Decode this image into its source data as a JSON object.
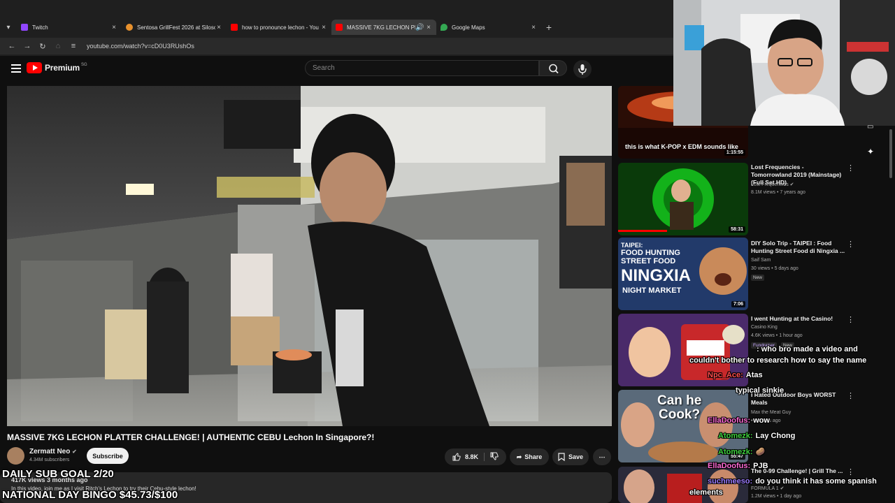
{
  "browser": {
    "tabs": [
      {
        "title": "Twitch",
        "favicon_color": "#9146ff",
        "active": false
      },
      {
        "title": "Sentosa GrillFest 2026 at Siloso",
        "favicon_color": "#e8912d",
        "active": false
      },
      {
        "title": "how to pronounce lechon - You",
        "favicon_color": "#ff0000",
        "active": false
      },
      {
        "title": "MASSIVE 7KG LECHON PLA",
        "favicon_color": "#ff0000",
        "active": true
      },
      {
        "title": "Google Maps",
        "favicon_color": "#34a853",
        "active": false
      }
    ],
    "url": "youtube.com/watch?v=cD0U3RUshOs"
  },
  "youtube": {
    "logo_text": "Premium",
    "logo_sup": "SG",
    "search_placeholder": "Search"
  },
  "video": {
    "title": "MASSIVE 7KG LECHON PLATTER CHALLENGE! | AUTHENTIC CEBU Lechon In Singapore?!",
    "channel_name": "Zermatt Neo",
    "subscribers": "4.34M subscribers",
    "subscribe_label": "Subscribe",
    "likes": "8.8K",
    "share_label": "Share",
    "save_label": "Save",
    "desc_meta": "417K views  3 months ago",
    "desc_text": "In this video, join me as I visit Ritch's Lechon to try their Cebu-style lechon!"
  },
  "recommendations": [
    {
      "title": "this is what K-POP x EDM sounds like",
      "duration": "1:15:55",
      "channel": "",
      "meta": "",
      "badges": []
    },
    {
      "title": "Lost Frequencies - Tomorrowland 2019 (Mainstage) (Full Set HD)",
      "duration": "58:31",
      "channel": "Lost Frequencies",
      "meta": "8.1M views • 7 years ago",
      "badges": []
    },
    {
      "title": "DIY Solo Trip - TAIPEI : Food Hunting Street Food di Ningxia ...",
      "duration": "7:06",
      "channel": "Saif Sam",
      "meta": "30 views • 5 days ago",
      "badges": [
        "New"
      ],
      "thumb_text": [
        "TAIPEI:",
        "FOOD HUNTING",
        "STREET FOOD",
        "NINGXIA",
        "NIGHT MARKET"
      ]
    },
    {
      "title": "I went Hunting at the Casino!",
      "duration": "",
      "channel": "Casino King",
      "meta": "4.6K views • 1 hour ago",
      "badges": [
        "Fundraiser",
        "New"
      ]
    },
    {
      "title": "I Rated Outdoor Boys WORST Meals",
      "duration": "55:47",
      "channel": "Max the Meat Guy",
      "meta": "• 12 days ago",
      "badges": [],
      "thumb_text": [
        "Can he",
        "Cook?"
      ]
    },
    {
      "title": "The 0-99 Challenge! | Grill The ...",
      "duration": "",
      "channel": "FORMULA 1",
      "meta": "1.2M views • 1 day ago",
      "badges": []
    }
  ],
  "overlay": {
    "goal_sub": "DAILY SUB GOAL 2/20",
    "goal_bingo": "NATIONAL DAY BINGO $45.73/$100"
  },
  "chat": [
    {
      "user": "",
      "message": ": who bro made a video and",
      "color": "#ffffff"
    },
    {
      "user": "",
      "message": "couldn't bother to research how to say the name",
      "color": "#ffffff"
    },
    {
      "user": "Npc_Ace:",
      "message": "Atas",
      "color": "#ff4d4d"
    },
    {
      "user": "",
      "message": "typical sinkie",
      "color": "#9b7bff"
    },
    {
      "user": "EllaDoofus:",
      "message": "wow",
      "color": "#ff6bd6"
    },
    {
      "user": "Atomezk:",
      "message": "Lay Chong",
      "color": "#3fd13f"
    },
    {
      "user": "Atomezk:",
      "message": "🥔",
      "color": "#3fd13f"
    },
    {
      "user": "EllaDoofus:",
      "message": "PJB",
      "color": "#ff6bd6"
    },
    {
      "user": "suchmeeso:",
      "message": "do you think it has some spanish",
      "color": "#9b7bff"
    },
    {
      "user": "",
      "message": "elements",
      "color": "#ffffff"
    }
  ]
}
